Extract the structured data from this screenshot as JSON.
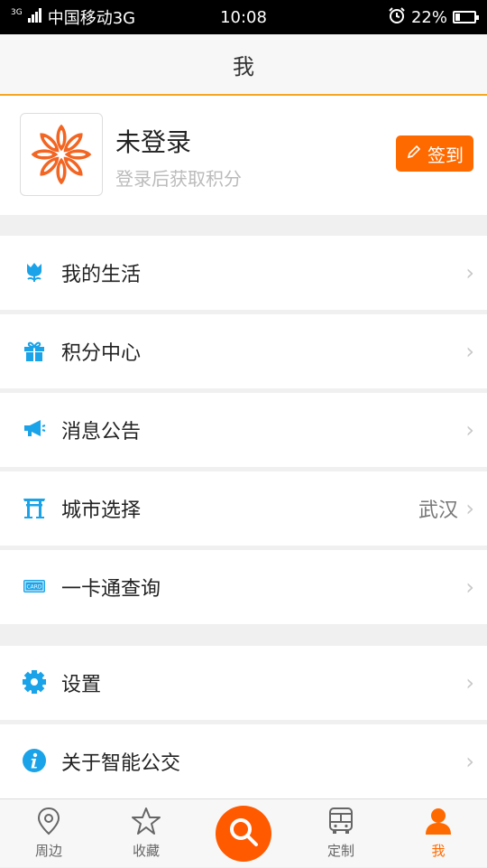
{
  "status_bar": {
    "network_small": "3G",
    "carrier": "中国移动3G",
    "time": "10:08",
    "battery": "22%",
    "battery_level": 0.22
  },
  "header": {
    "title": "我"
  },
  "profile": {
    "name": "未登录",
    "subtitle": "登录后获取积分",
    "signin_label": "签到"
  },
  "menu": [
    {
      "label": "我的生活",
      "icon": "tulip-icon",
      "value": ""
    },
    {
      "label": "积分中心",
      "icon": "gift-icon",
      "value": ""
    },
    {
      "label": "消息公告",
      "icon": "megaphone-icon",
      "value": ""
    },
    {
      "label": "城市选择",
      "icon": "city-gate-icon",
      "value": "武汉"
    },
    {
      "label": "一卡通查询",
      "icon": "card-icon",
      "value": ""
    },
    {
      "label": "设置",
      "icon": "gear-icon",
      "value": ""
    },
    {
      "label": "关于智能公交",
      "icon": "info-icon",
      "value": ""
    }
  ],
  "card_icon_text": "CARD",
  "chevron": "›",
  "tabs": [
    {
      "label": "周边",
      "icon": "location-pin-icon"
    },
    {
      "label": "收藏",
      "icon": "star-icon"
    },
    {
      "label": "",
      "icon": "search-icon"
    },
    {
      "label": "定制",
      "icon": "bus-icon"
    },
    {
      "label": "我",
      "icon": "person-icon",
      "active": true
    }
  ],
  "colors": {
    "accent": "#ff6a00",
    "icon_blue": "#1aa3e8",
    "header_divider": "#f5a623"
  }
}
